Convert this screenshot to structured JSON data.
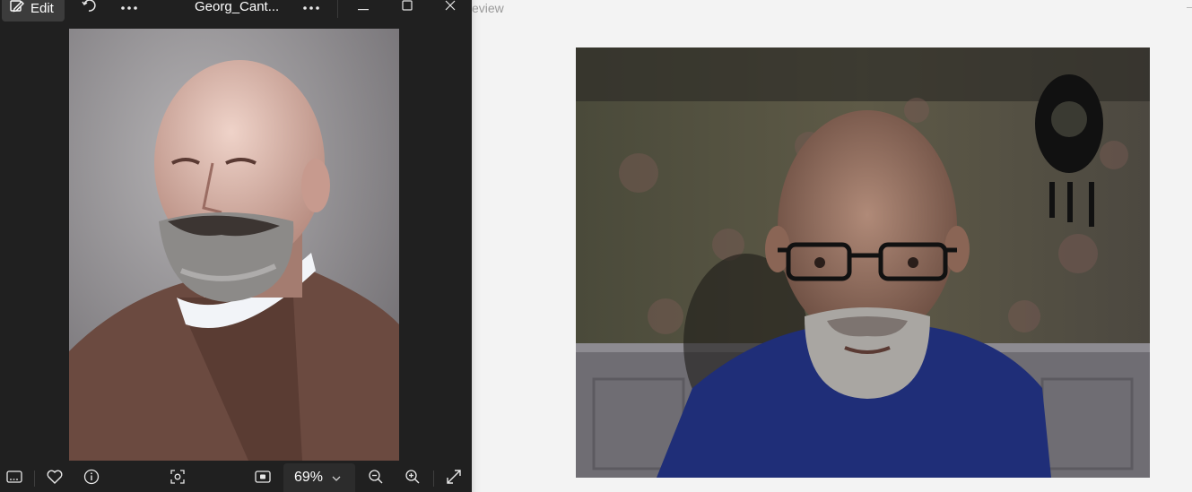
{
  "viewer": {
    "edit_label": "Edit",
    "file_title": "Georg_Cant...",
    "zoom_value": "69%",
    "toolbar_icons": [
      "edit-icon",
      "rotate-icon",
      "more-icon",
      "more-icon",
      "minimize-icon",
      "maximize-icon",
      "close-icon"
    ],
    "bottom_icons": [
      "filmstrip-icon",
      "favorite-heart-icon",
      "info-icon",
      "visual-search-icon",
      "fit-to-window-icon",
      "zoom-out-icon",
      "zoom-in-icon",
      "fullscreen-icon"
    ]
  },
  "background_window": {
    "title_fragment": "eview"
  },
  "colors": {
    "viewer_bg": "#202020",
    "toolbar_button_bg": "#3c3c3c",
    "preview_bg": "#f3f3f3",
    "sweater_blue": "#1f2e78"
  }
}
